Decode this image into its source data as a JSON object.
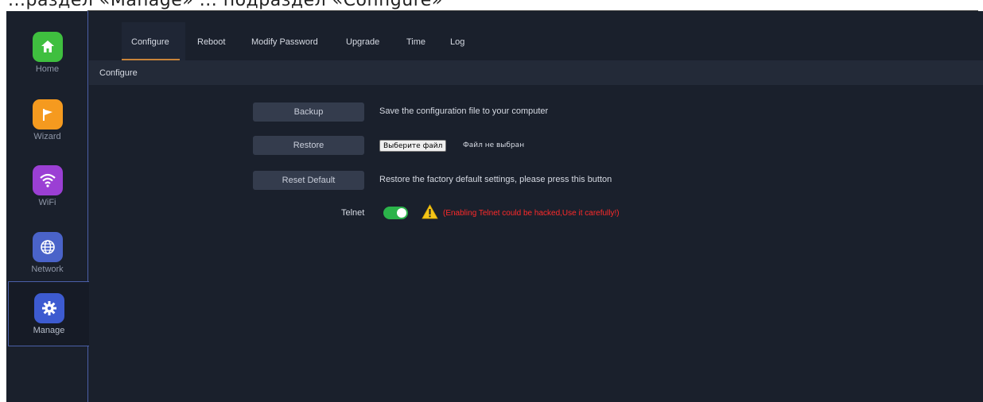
{
  "caption_fragment": "...раздел «Manage» ... подраздел «Configure»",
  "sidebar": {
    "items": [
      {
        "label": "Home",
        "icon": "home-icon",
        "color": "#3fbf3f"
      },
      {
        "label": "Wizard",
        "icon": "flag-icon",
        "color": "#f59a1f"
      },
      {
        "label": "WiFi",
        "icon": "wifi-icon",
        "color": "#9b3fd4"
      },
      {
        "label": "Network",
        "icon": "globe-icon",
        "color": "#4a63c9"
      },
      {
        "label": "Manage",
        "icon": "gear-icon",
        "color": "#3d5bd0",
        "active": true
      }
    ]
  },
  "tabs": [
    {
      "label": "Configure",
      "active": true
    },
    {
      "label": "Reboot"
    },
    {
      "label": "Modify Password"
    },
    {
      "label": "Upgrade"
    },
    {
      "label": "Time"
    },
    {
      "label": "Log"
    }
  ],
  "breadcrumb": "Configure",
  "actions": {
    "backup": {
      "label": "Backup",
      "description": "Save the configuration file to your computer"
    },
    "restore": {
      "label": "Restore",
      "file_button": "Выберите файл",
      "file_status": "Файл не выбран"
    },
    "reset": {
      "label": "Reset Default",
      "description": "Restore the factory default settings, please press this button"
    }
  },
  "telnet": {
    "label": "Telnet",
    "enabled": true,
    "warning": "(Enabling Telnet could be hacked,Use it carefully!)"
  },
  "colors": {
    "accent": "#c8833a",
    "toggle_on": "#2bb34a",
    "warning": "#ff2a2a",
    "warning_icon": "#f5c518"
  }
}
